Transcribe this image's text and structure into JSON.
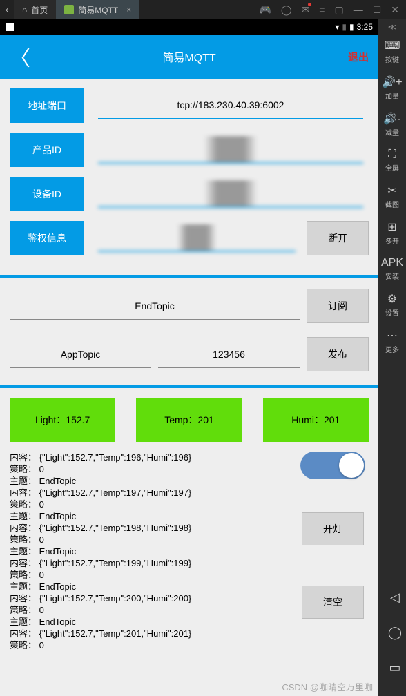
{
  "top": {
    "home_label": "首页",
    "active_tab": "简易MQTT",
    "close_x": "×"
  },
  "statusbar": {
    "time": "3:25"
  },
  "header": {
    "title": "简易MQTT",
    "exit": "退出"
  },
  "config": {
    "addr_label": "地址端口",
    "addr_value": "tcp://183.230.40.39:6002",
    "product_label": "产品ID",
    "device_label": "设备ID",
    "auth_label": "鉴权信息",
    "disconnect": "断开"
  },
  "sub": {
    "topic_value": "EndTopic",
    "btn": "订阅"
  },
  "pub": {
    "topic_value": "AppTopic",
    "msg_value": "123456",
    "btn": "发布"
  },
  "sensors": {
    "light": "Light：152.7",
    "temp": "Temp：201",
    "humi": "Humi：201"
  },
  "log_lines": [
    "内容： {\"Light\":152.7,\"Temp\":196,\"Humi\":196}",
    "策略： 0",
    "主题： EndTopic",
    "内容： {\"Light\":152.7,\"Temp\":197,\"Humi\":197}",
    "策略： 0",
    "主题： EndTopic",
    "内容： {\"Light\":152.7,\"Temp\":198,\"Humi\":198}",
    "策略： 0",
    "主题： EndTopic",
    "内容： {\"Light\":152.7,\"Temp\":199,\"Humi\":199}",
    "策略： 0",
    "主题： EndTopic",
    "内容： {\"Light\":152.7,\"Temp\":200,\"Humi\":200}",
    "策略： 0",
    "主题： EndTopic",
    "内容： {\"Light\":152.7,\"Temp\":201,\"Humi\":201}",
    "策略： 0"
  ],
  "log_side": {
    "light_btn": "开灯",
    "clear_btn": "清空"
  },
  "sidebar": [
    {
      "icon": "⌨",
      "label": "按键"
    },
    {
      "icon": "🔊+",
      "label": "加量"
    },
    {
      "icon": "🔊-",
      "label": "减量"
    },
    {
      "icon": "⛶",
      "label": "全屏"
    },
    {
      "icon": "✂",
      "label": "截图"
    },
    {
      "icon": "⊞",
      "label": "多开"
    },
    {
      "icon": "APK",
      "label": "安装"
    },
    {
      "icon": "⚙",
      "label": "设置"
    },
    {
      "icon": "⋯",
      "label": "更多"
    }
  ],
  "watermark": "CSDN @咖晴空万里咖"
}
